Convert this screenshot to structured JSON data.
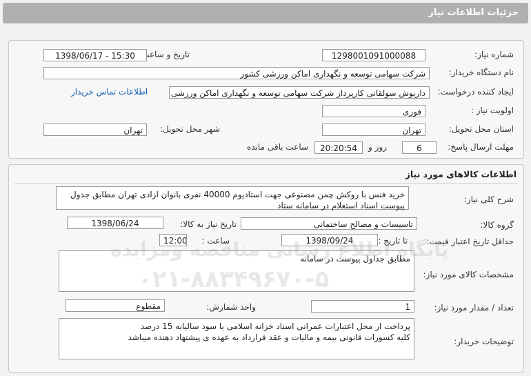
{
  "header": {
    "title": "جزئیات اطلاعات نیاز"
  },
  "need_info": {
    "need_number_label": "شماره نیاز:",
    "need_number": "1298001091000088",
    "announce_label": "تاریخ و ساعت اعلان عمومی:",
    "announce_value": "1398/06/17 - 15:30",
    "buyer_org_label": "نام دستگاه خریدار:",
    "buyer_org": "شرکت سهامی توسعه و نگهداری اماکن ورزشی کشور",
    "creator_label": "ایجاد کننده درخواست:",
    "creator": "داریوش سولقانی کارپرداز شرکت سهامی توسعه و نگهداری اماکن ورزشی کشور",
    "contact_link": "اطلاعات تماس خریدار",
    "priority_label": "اولویت نیاز :",
    "priority": "فوری",
    "province_label": "استان محل تحویل:",
    "province": "تهران",
    "city_label": "شهر محل تحویل:",
    "city": "تهران",
    "deadline_label": "مهلت ارسال پاسخ:",
    "days": "6",
    "days_unit": "روز و",
    "time_left": "20:20:54",
    "time_left_suffix": "ساعت باقی مانده"
  },
  "goods": {
    "section_title": "اطلاعات کالاهای مورد نیاز",
    "summary_label": "شرح کلی نیاز:",
    "summary": "خرید فنس با روکش چمن مصنوعی جهت استادیوم 40000 نفری بانوان ازادی تهران مطابق جدول پیوست اسناد استعلام در سامانه ستاد",
    "group_label": "گروه کالا:",
    "group": "تاسیسات و مصالح ساختمانی",
    "need_date_label": "تاریخ نیاز به کالا:",
    "need_date": "1398/06/24",
    "validity_label": "حداقل تاریخ اعتبار قیمت:",
    "to_date_label": "تا تاریخ :",
    "to_date": "1398/09/24",
    "hour_label": "ساعت :",
    "hour": "12:00",
    "specs_label": "مشخصات کالای مورد نیاز:",
    "specs": "مطابق جداول پیوست در سامانه",
    "qty_label": "تعداد / مقدار مورد نیاز:",
    "qty": "1",
    "unit_label": "واحد شمارش:",
    "unit": "مقطوع",
    "buyer_notes_label": "توضیحات خریدار:",
    "buyer_notes_line1": "پرداخت از محل اعتبارات عمرانی اسناد خزانه اسلامی با سود سالیانه 15 درصد",
    "buyer_notes_line2": "کلیه کسورات قانونی بیمه و مالیات و عقد قرارداد به عهده ی پیشنهاد دهنده میباشد"
  },
  "watermark": {
    "line1": "پایگاه اطلاع رسانی مناقصه ومزایده",
    "line2": "۰۲۱-۸۸۳۴۹۶۷۰-۵"
  }
}
